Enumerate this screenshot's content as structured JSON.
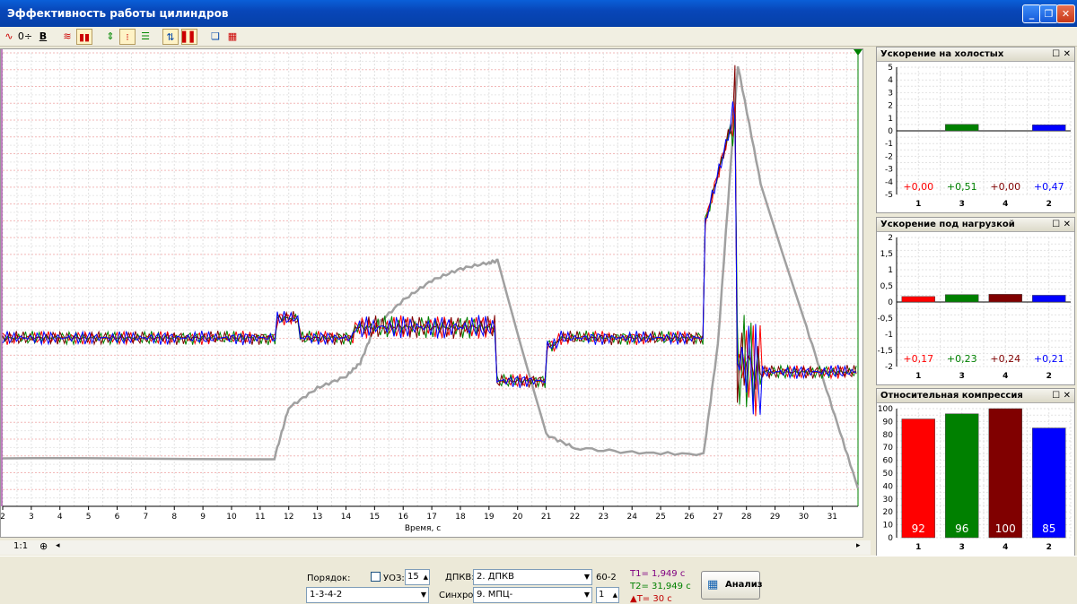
{
  "window": {
    "title": "Эффективность работы цилиндров"
  },
  "toolbar": {
    "icons": [
      "offset-curve-icon",
      "zero-spin-icon",
      "bold-icon",
      "curves-icon",
      "bar-mode-icon",
      "arrows-icon",
      "markers-icon",
      "list-icon",
      "sort-icon",
      "bars-icon",
      "copy-icon",
      "report-icon"
    ],
    "zero_label": "0÷",
    "bold_label": "B"
  },
  "main_chart": {
    "xlabel": "Время, с",
    "ticks": [
      "2",
      "3",
      "4",
      "5",
      "6",
      "7",
      "8",
      "9",
      "10",
      "11",
      "12",
      "13",
      "14",
      "15",
      "16",
      "17",
      "18",
      "19",
      "20",
      "21",
      "22",
      "23",
      "24",
      "25",
      "26",
      "27",
      "28",
      "29",
      "30",
      "31"
    ]
  },
  "panels": [
    {
      "title": "Ускорение на холостых",
      "yticks": [
        "5",
        "4",
        "3",
        "2",
        "1",
        "0",
        "-1",
        "-2",
        "-3",
        "-4",
        "-5"
      ],
      "labels": [
        "+0,00",
        "+0,51",
        "+0,00",
        "+0,47"
      ],
      "cats": [
        "1",
        "3",
        "4",
        "2"
      ]
    },
    {
      "title": "Ускорение под нагрузкой",
      "yticks": [
        "2",
        "1,5",
        "1",
        "0,5",
        "0",
        "-0,5",
        "-1",
        "-1,5",
        "-2"
      ],
      "labels": [
        "+0,17",
        "+0,23",
        "+0,24",
        "+0,21"
      ],
      "cats": [
        "1",
        "3",
        "4",
        "2"
      ]
    },
    {
      "title": "Относительная компрессия",
      "yticks": [
        "100",
        "90",
        "80",
        "70",
        "60",
        "50",
        "40",
        "30",
        "20",
        "10",
        "0"
      ],
      "labels": [
        "92",
        "96",
        "100",
        "85"
      ],
      "cats": [
        "1",
        "3",
        "4",
        "2"
      ]
    }
  ],
  "colors": {
    "c1": "#ff0000",
    "c3": "#008000",
    "c4": "#800000",
    "c2": "#0000ff",
    "ref": "#a0a0a0"
  },
  "chart_data": [
    {
      "type": "line",
      "xlabel": "Время, с",
      "xlim": [
        2,
        31.9
      ],
      "series": []
    },
    {
      "type": "bar",
      "title": "Ускорение на холостых",
      "categories": [
        "1",
        "3",
        "4",
        "2"
      ],
      "values": [
        0,
        0.51,
        0,
        0.47
      ],
      "ylim": [
        -5,
        5
      ]
    },
    {
      "type": "bar",
      "title": "Ускорение под нагрузкой",
      "categories": [
        "1",
        "3",
        "4",
        "2"
      ],
      "values": [
        0.17,
        0.23,
        0.24,
        0.21
      ],
      "ylim": [
        -2,
        2
      ]
    },
    {
      "type": "bar",
      "title": "Относительная компрессия",
      "categories": [
        "1",
        "3",
        "4",
        "2"
      ],
      "values": [
        92,
        96,
        100,
        85
      ],
      "ylim": [
        0,
        100
      ]
    }
  ],
  "scroll": {
    "zoom": "1:1"
  },
  "bottom": {
    "order_label": "Порядок:",
    "order_value": "1-3-4-2",
    "uoz_label": "УОЗ:",
    "uoz_value": "15",
    "dpkv_label": "ДПКВ:",
    "dpkv_value": "2. ДПКВ",
    "dpkv_type": "60-2",
    "sync_label": "Синхро:",
    "sync_value": "9. МПЦ-",
    "sync_spin": "1",
    "t1": "T1= 1,949 с",
    "t2": "T2= 31,949 с",
    "dt": "▲T= 30 с",
    "analyze": "Анализ"
  }
}
